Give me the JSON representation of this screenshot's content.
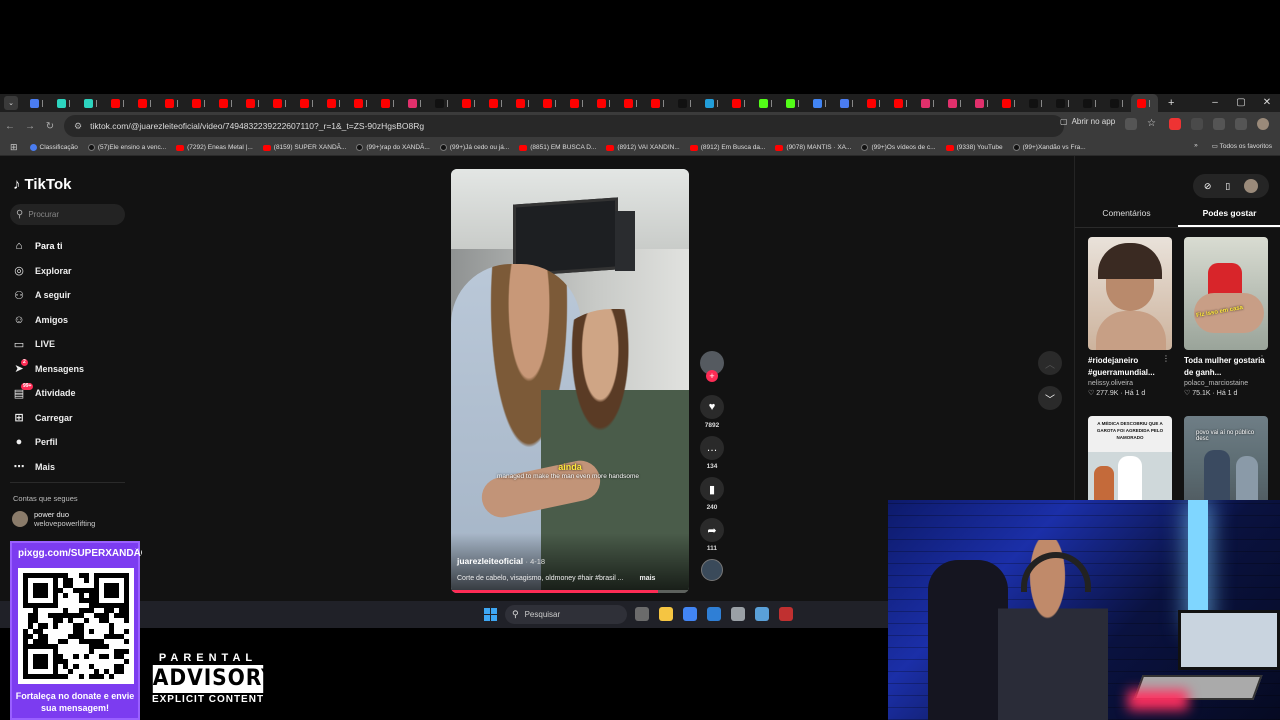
{
  "browser": {
    "tab_favicon_colors": [
      "#4a7cf0",
      "#2dd4bf",
      "#2dd4bf",
      "#ff0000",
      "#ff0000",
      "#ff0000",
      "#ff0000",
      "#ff0000",
      "#ff0000",
      "#ff0000",
      "#ff0000",
      "#ff0000",
      "#ff0000",
      "#ff0000",
      "#e1306c",
      "#111111",
      "#ff0000",
      "#ff0000",
      "#ff0000",
      "#ff0000",
      "#ff0000",
      "#ff0000",
      "#ff0000",
      "#ff0000",
      "#111111",
      "#229ed9",
      "#ff0000",
      "#53fc18",
      "#53fc18",
      "#4285f4",
      "#4a7cf0",
      "#ff0000",
      "#ff0000",
      "#e1306c",
      "#e1306c",
      "#e1306c",
      "#ff0000",
      "#111111",
      "#111111",
      "#111111",
      "#111111",
      "#ff0000"
    ],
    "new_tab": "+",
    "window_controls": [
      "–",
      "▢",
      "✕"
    ],
    "url": "tiktok.com/@juarezleiteoficial/video/7494832239222607110?_r=1&_t=ZS-90zHgsBO8Rg",
    "open_in_app": "Abrir no app",
    "bookmarks": [
      {
        "label": "Classificação",
        "type": "g"
      },
      {
        "label": "(57)Ele ensino a venc...",
        "type": "tt"
      },
      {
        "label": "(7292) Eneas Metal |...",
        "type": "yt"
      },
      {
        "label": "(8159) SUPER XANDÃ...",
        "type": "yt"
      },
      {
        "label": "(99+)rap do XANDÃ...",
        "type": "tt"
      },
      {
        "label": "(99+)Já cedo ou já...",
        "type": "tt"
      },
      {
        "label": "(8851) EM BUSCA D...",
        "type": "yt"
      },
      {
        "label": "(8912) VAI XANDIN...",
        "type": "yt"
      },
      {
        "label": "(8912) Em Busca da...",
        "type": "yt"
      },
      {
        "label": "(9078) MANTIS · XA...",
        "type": "yt"
      },
      {
        "label": "(99+)Os vídeos de c...",
        "type": "tt"
      },
      {
        "label": "(9338) YouTube",
        "type": "yt"
      },
      {
        "label": "(99+)Xandão vs Fra...",
        "type": "tt"
      }
    ],
    "all_bookmarks": "Todos os favoritos"
  },
  "tiktok": {
    "logo": "TikTok",
    "search_placeholder": "Procurar",
    "nav": [
      {
        "label": "Para ti",
        "icon": "⌂",
        "name": "home-icon"
      },
      {
        "label": "Explorar",
        "icon": "◎",
        "name": "compass-icon"
      },
      {
        "label": "A seguir",
        "icon": "⚇",
        "name": "following-icon"
      },
      {
        "label": "Amigos",
        "icon": "☺",
        "name": "friends-icon"
      },
      {
        "label": "LIVE",
        "icon": "▭",
        "name": "live-icon"
      },
      {
        "label": "Mensagens",
        "icon": "➤",
        "name": "messages-icon",
        "badge": "2"
      },
      {
        "label": "Atividade",
        "icon": "▤",
        "name": "activity-icon",
        "badge": "99+"
      },
      {
        "label": "Carregar",
        "icon": "⊞",
        "name": "upload-icon"
      },
      {
        "label": "Perfil",
        "icon": "●",
        "name": "profile-icon"
      },
      {
        "label": "Mais",
        "icon": "⋯",
        "name": "more-icon"
      }
    ],
    "following_title": "Contas que segues",
    "following": {
      "name": "power duo",
      "handle": "welovepowerlifting"
    },
    "video": {
      "caption_yellow": "ainda",
      "caption_white": "managed to make the man even more handsome",
      "author": "juarezleiteoficial",
      "date": "· 4-18",
      "description": "Corte de cabelo, visagismo, oldmoney #hair #brasil ...",
      "more": "mais",
      "progress": 0.87
    },
    "actions": {
      "likes": "7892",
      "comments": "134",
      "saves": "240",
      "shares": "111"
    },
    "right_panel": {
      "tabs": [
        "Comentários",
        "Podes gostar"
      ],
      "active_tab": 1,
      "cards": [
        {
          "title": "#riodejaneiro #guerramundial...",
          "user": "nelissy.oliveira",
          "likes": "277.9K",
          "age": "Há 1 d"
        },
        {
          "title": "Toda mulher gostaria de ganh...",
          "user": "polaco_marciostaine",
          "likes": "75.1K",
          "age": "Há 1 d",
          "overlay": "Fiz isso em casa"
        },
        {
          "overlay": "A MÉDICA DESCOBRIU QUE A GAROTA FOI AGREDIDA PELO NAMORADO"
        },
        {
          "overlay": "povo vai aí no público desc"
        }
      ]
    }
  },
  "taskbar": {
    "search_placeholder": "Pesquisar",
    "app_colors": [
      "#6b6b6b",
      "#f5c542",
      "#4285f4",
      "#2f7fd6",
      "#9aa0a6",
      "#5aa0d8",
      "#c03030"
    ]
  },
  "overlays": {
    "qr_url": "pixgg.com/SUPERXANDÃO",
    "qr_text": "Fortaleça no donate e envie sua mensagem!",
    "advisory": {
      "line1": "PARENTAL",
      "line2": "ADVISORY",
      "line3": "EXPLICIT CONTENT"
    }
  }
}
